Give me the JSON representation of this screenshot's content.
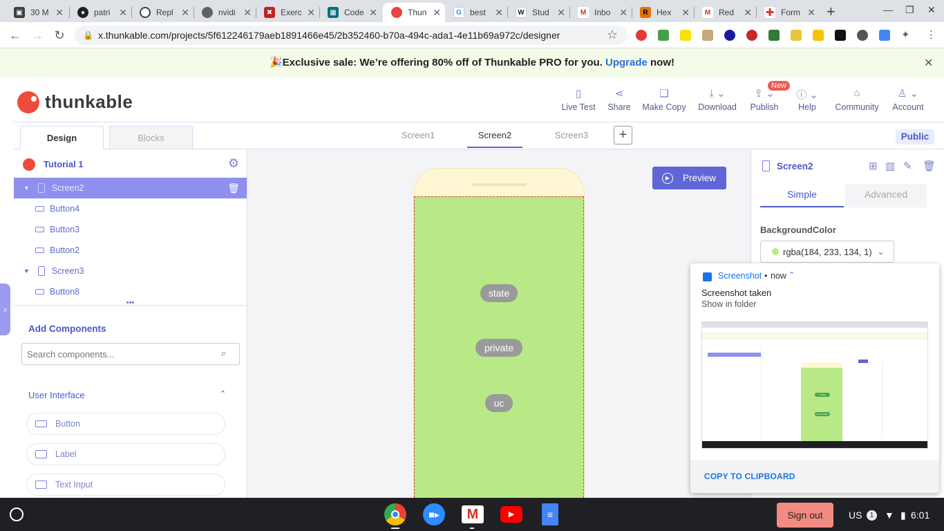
{
  "browser": {
    "tabs": [
      {
        "label": "30 M",
        "favicon": "briefcase-icon",
        "color": "#3c4043"
      },
      {
        "label": "patri",
        "favicon": "github-icon",
        "color": "#202124"
      },
      {
        "label": "Repl",
        "favicon": "replit-icon",
        "color": "#3c4043"
      },
      {
        "label": "nvidi",
        "favicon": "globe-icon",
        "color": "#5f6368"
      },
      {
        "label": "Exerc",
        "favicon": "exercism-icon",
        "color": "#c5221f"
      },
      {
        "label": "Code",
        "favicon": "code-icon",
        "color": "#0b6e7a"
      },
      {
        "label": "Thun",
        "favicon": "thunkable-icon",
        "color": "#e8453c"
      },
      {
        "label": "best",
        "favicon": "google-icon",
        "color": "#4285f4"
      },
      {
        "label": "Stud",
        "favicon": "wikipedia-icon",
        "color": "#202124"
      },
      {
        "label": "Inbo",
        "favicon": "gmail-icon",
        "color": "#d93025"
      },
      {
        "label": "Hex",
        "favicon": "r-icon",
        "color": "#e37400"
      },
      {
        "label": "Red",
        "favicon": "gmail-icon",
        "color": "#d93025"
      },
      {
        "label": "Form",
        "favicon": "red-cross-icon",
        "color": "#d93025"
      }
    ],
    "new_tab_symbol": "+",
    "url": "x.thunkable.com/projects/5f612246179aeb1891466e45/2b352460-b70a-494c-ada1-4e11b69a972c/designer"
  },
  "banner": {
    "emoji": "🎉",
    "text": "Exclusive sale: We’re offering 80% off of Thunkable PRO for you.",
    "link": "Upgrade",
    "suffix": "now!"
  },
  "header": {
    "logo_text": "thunkable",
    "actions": [
      {
        "label": "Live Test",
        "icon": "phone-icon"
      },
      {
        "label": "Share",
        "icon": "share-icon"
      },
      {
        "label": "Make Copy",
        "icon": "copy-icon"
      },
      {
        "label": "Download",
        "icon": "download-icon"
      },
      {
        "label": "Publish",
        "icon": "publish-icon",
        "badge": "New"
      },
      {
        "label": "Help",
        "icon": "info-icon"
      },
      {
        "label": "Community",
        "icon": "community-icon"
      },
      {
        "label": "Account",
        "icon": "user-icon"
      }
    ]
  },
  "mode_tabs": {
    "design": "Design",
    "blocks": "Blocks"
  },
  "screen_tabs": [
    "Screen1",
    "Screen2",
    "Screen3"
  ],
  "active_screen": "Screen2",
  "public_label": "Public",
  "left": {
    "project_name": "Tutorial 1",
    "tree": [
      {
        "label": "Screen2",
        "type": "screen",
        "selected": true
      },
      {
        "label": "Button4",
        "type": "button"
      },
      {
        "label": "Button3",
        "type": "button"
      },
      {
        "label": "Button2",
        "type": "button"
      },
      {
        "label": "Screen3",
        "type": "screen"
      },
      {
        "label": "Button8",
        "type": "button"
      }
    ],
    "add_components": "Add Components",
    "search_placeholder": "Search components...",
    "category": "User Interface",
    "components": [
      "Button",
      "Label",
      "Text Input"
    ]
  },
  "canvas": {
    "preview_label": "Preview",
    "buttons": [
      "state",
      "private",
      "uc"
    ],
    "screen_color": "#b8e986"
  },
  "right": {
    "title": "Screen2",
    "tabs": {
      "simple": "Simple",
      "advanced": "Advanced"
    },
    "bg_label": "BackgroundColor",
    "bg_value": "rgba(184, 233, 134, 1)"
  },
  "notification": {
    "app": "Screenshot",
    "time": "now",
    "title": "Screenshot taken",
    "subtitle": "Show in folder",
    "action": "COPY TO CLIPBOARD",
    "thumb_buttons": [
      "In State",
      "Out of State"
    ]
  },
  "taskbar": {
    "sign_out": "Sign out",
    "ime": "US",
    "ime_badge": "1",
    "time": "6:01",
    "apps": [
      "chrome-icon",
      "zoom-icon",
      "gmail-icon",
      "youtube-icon",
      "docs-icon"
    ]
  },
  "colors": {
    "accent": "#7b80e8",
    "selected_row": "#8f8ff0",
    "link": "#2f6ce5",
    "banner_bg": "#f4fbe8",
    "sign_out_bg": "#f28b82"
  }
}
